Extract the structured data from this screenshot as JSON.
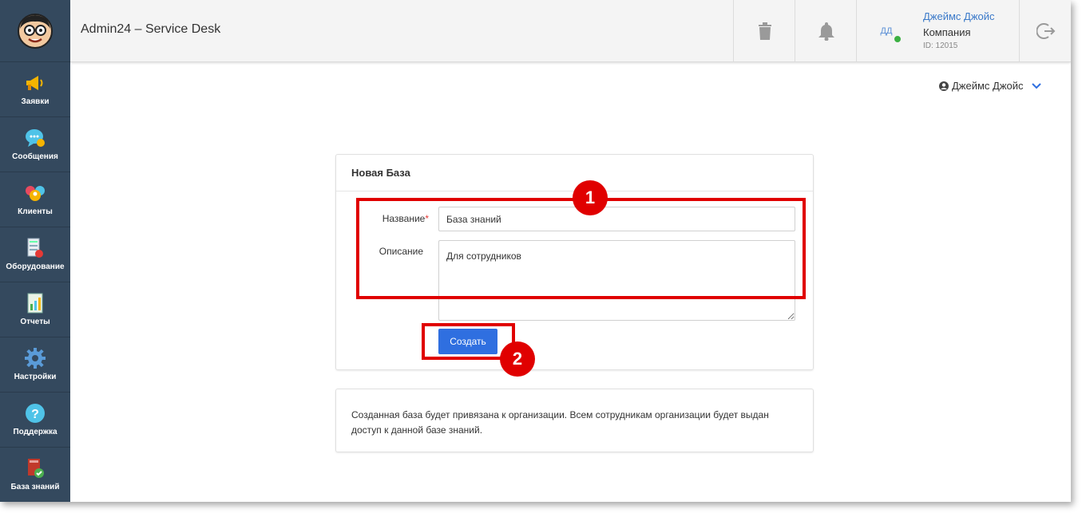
{
  "header": {
    "app_title": "Admin24 – Service Desk",
    "user": {
      "name": "Джеймс Джойс",
      "company": "Компания",
      "id": "ID: 12015",
      "initials": "ДД"
    }
  },
  "sidebar": {
    "items": [
      {
        "label": "Заявки",
        "icon": "megaphone-icon"
      },
      {
        "label": "Сообщения",
        "icon": "chat-bubble-icon"
      },
      {
        "label": "Клиенты",
        "icon": "clients-icon"
      },
      {
        "label": "Оборудование",
        "icon": "equipment-icon"
      },
      {
        "label": "Отчеты",
        "icon": "report-icon"
      },
      {
        "label": "Настройки",
        "icon": "gear-icon"
      },
      {
        "label": "Поддержка",
        "icon": "help-icon"
      },
      {
        "label": "База знаний",
        "icon": "book-icon"
      }
    ]
  },
  "user_menu": {
    "label": "Джеймс Джойс"
  },
  "form": {
    "title": "Новая База",
    "name_label": "Название",
    "required_mark": "*",
    "name_value": "База знаний",
    "description_label": "Описание",
    "description_value": "Для сотрудников",
    "submit_label": "Создать"
  },
  "info": {
    "text": "Созданная база будет привязана к организации. Всем сотрудникам организации будет выдан доступ к данной базе знаний."
  },
  "annotations": {
    "step1": "1",
    "step2": "2"
  },
  "colors": {
    "sidebar": "#34495e",
    "accent": "#2f6fe0",
    "annotation": "#e00000",
    "link": "#3a79c9"
  }
}
